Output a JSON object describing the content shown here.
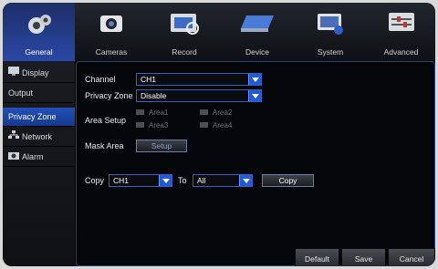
{
  "tabs": [
    {
      "label": "General",
      "icon": "gear-icon",
      "active": true
    },
    {
      "label": "Cameras",
      "icon": "camera-icon"
    },
    {
      "label": "Record",
      "icon": "record-icon"
    },
    {
      "label": "Device",
      "icon": "device-icon"
    },
    {
      "label": "System",
      "icon": "system-icon"
    },
    {
      "label": "Advanced",
      "icon": "advanced-icon"
    }
  ],
  "sidebar": {
    "items": [
      {
        "label": "Display",
        "icon": "display-icon"
      },
      {
        "label": "Output"
      },
      {
        "label": "Privacy Zone",
        "active": true
      },
      {
        "label": "Network",
        "icon": "network-icon"
      },
      {
        "label": "Alarm",
        "icon": "alarm-icon"
      }
    ]
  },
  "form": {
    "channel_label": "Channel",
    "channel_value": "CH1",
    "privacy_label": "Privacy Zone",
    "privacy_value": "Disable",
    "area_label": "Area Setup",
    "areas": [
      "Area1",
      "Area2",
      "Area3",
      "Area4"
    ],
    "mask_label": "Mask Area",
    "setup_label": "Setup",
    "copy_label": "Copy",
    "copy_from": "CH1",
    "to_label": "To",
    "copy_to": "All",
    "copy_button": "Copy"
  },
  "footer": {
    "default_label": "Default",
    "save_label": "Save",
    "cancel_label": "Cancel"
  },
  "colors": {
    "accent": "#2450b8",
    "arrow": "#1d5bd8"
  }
}
